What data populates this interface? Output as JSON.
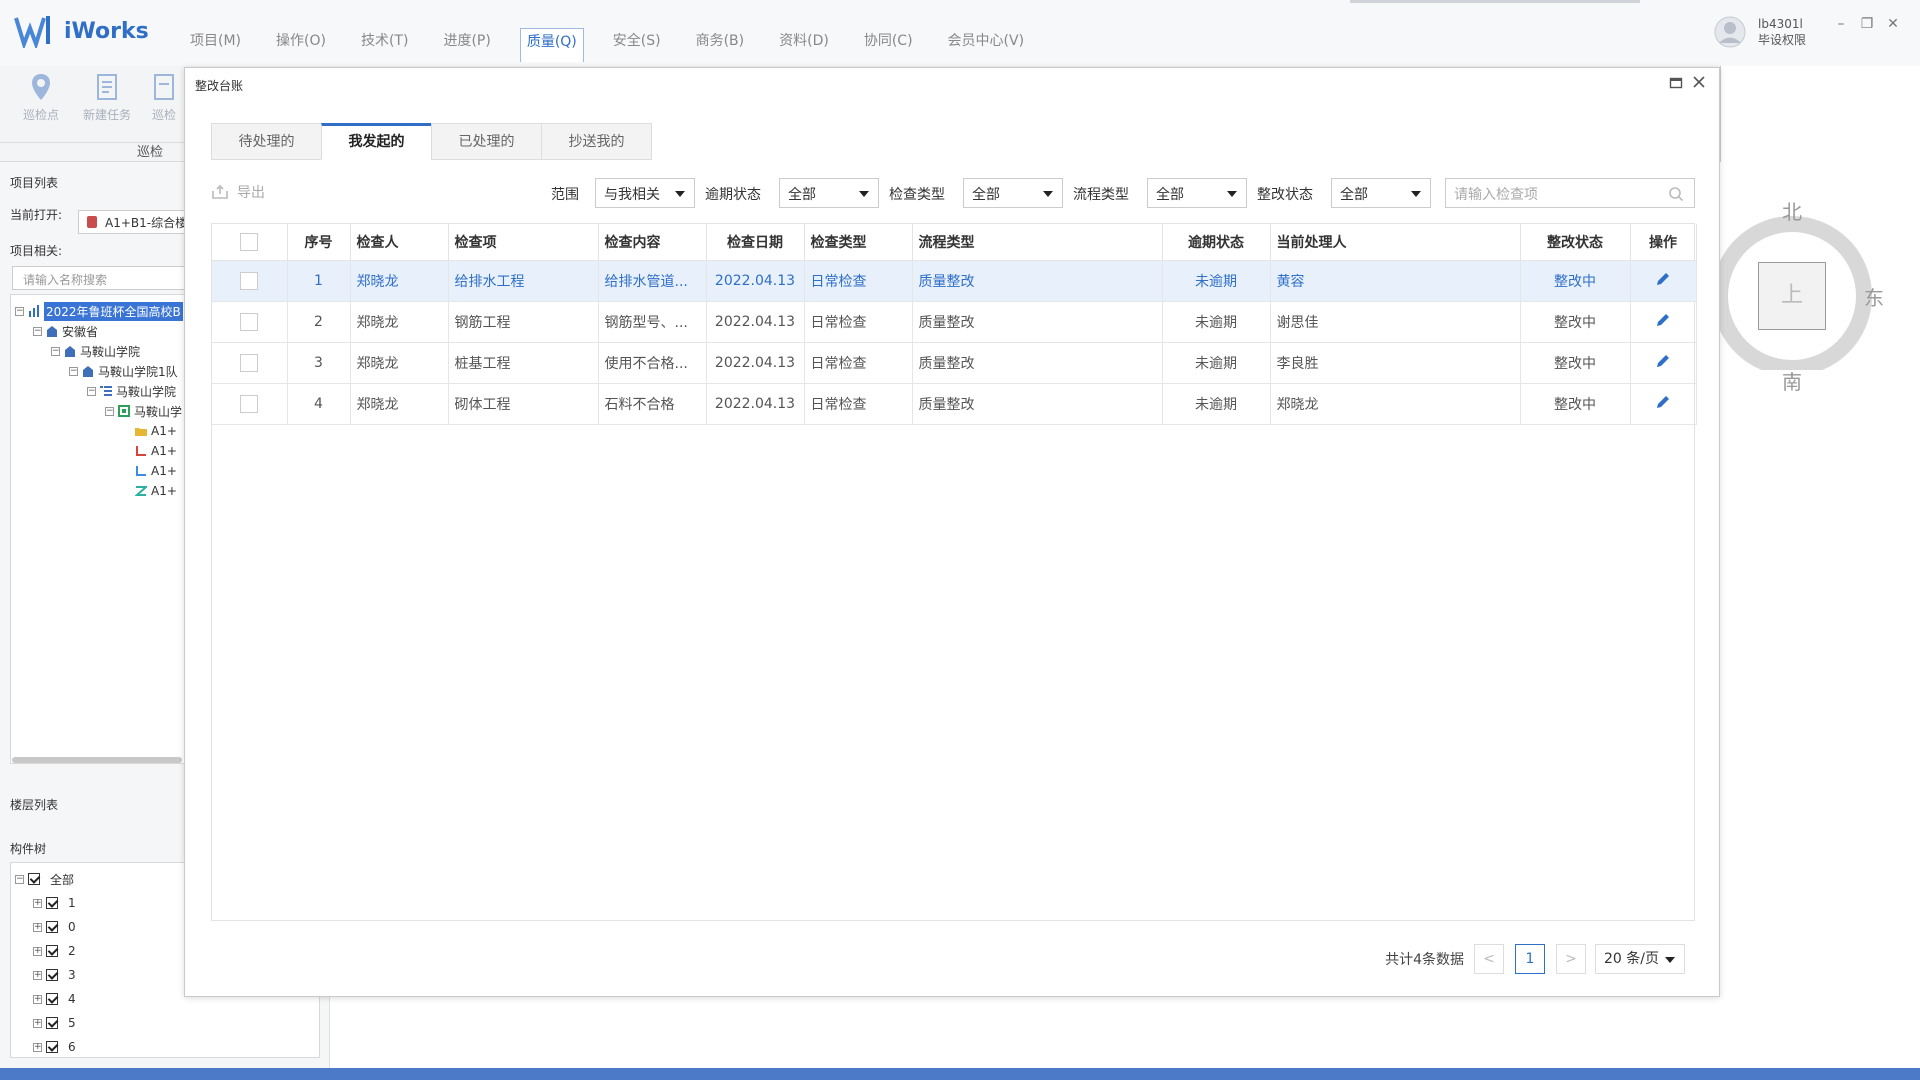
{
  "app": {
    "name": "iWorks"
  },
  "menus": [
    {
      "label": "项目(M)"
    },
    {
      "label": "操作(O)"
    },
    {
      "label": "技术(T)"
    },
    {
      "label": "进度(P)"
    },
    {
      "label": "质量(Q)",
      "active": true
    },
    {
      "label": "安全(S)"
    },
    {
      "label": "商务(B)"
    },
    {
      "label": "资料(D)"
    },
    {
      "label": "协同(C)"
    },
    {
      "label": "会员中心(V)"
    }
  ],
  "user": {
    "name": "lb4301l",
    "role": "毕设权限"
  },
  "window_controls": {
    "minimize": "–",
    "restore": "❐",
    "close": "✕"
  },
  "ribbon": {
    "buttons": [
      {
        "label": "巡检点"
      },
      {
        "label": "新建任务"
      },
      {
        "label": "巡检"
      }
    ],
    "group_label": "巡检"
  },
  "left_panel": {
    "project_list_title": "项目列表",
    "current_open_label": "当前打开:",
    "current_open_value": "A1+B1-综合楼",
    "project_related_label": "项目相关:",
    "search_placeholder": "请输入名称搜索",
    "tree": [
      {
        "label": "2022年鲁班杯全国高校B"
      },
      {
        "label": "安徽省"
      },
      {
        "label": "马鞍山学院"
      },
      {
        "label": "马鞍山学院1队"
      },
      {
        "label": "马鞍山学院"
      },
      {
        "label": "马鞍山学"
      },
      {
        "label": "A1+"
      },
      {
        "label": "A1+"
      },
      {
        "label": "A1+"
      },
      {
        "label": "A1+"
      }
    ],
    "floor_list_title": "楼层列表",
    "component_tree_title": "构件树",
    "component_tree": [
      {
        "label": "全部"
      },
      {
        "label": "1"
      },
      {
        "label": "0"
      },
      {
        "label": "2"
      },
      {
        "label": "3"
      },
      {
        "label": "4"
      },
      {
        "label": "5"
      },
      {
        "label": "6"
      }
    ]
  },
  "compass": {
    "north": "北",
    "east": "东",
    "south": "南",
    "center": "上"
  },
  "dialog": {
    "title": "整改台账",
    "tabs": [
      {
        "label": "待处理的"
      },
      {
        "label": "我发起的",
        "active": true
      },
      {
        "label": "已处理的"
      },
      {
        "label": "抄送我的"
      }
    ],
    "export_label": "导出",
    "filters": [
      {
        "label": "范围",
        "value": "与我相关"
      },
      {
        "label": "逾期状态",
        "value": "全部"
      },
      {
        "label": "检查类型",
        "value": "全部"
      },
      {
        "label": "流程类型",
        "value": "全部"
      },
      {
        "label": "整改状态",
        "value": "全部"
      }
    ],
    "search_placeholder": "请输入检查项",
    "table": {
      "columns": [
        "序号",
        "检查人",
        "检查项",
        "检查内容",
        "检查日期",
        "检查类型",
        "流程类型",
        "逾期状态",
        "当前处理人",
        "整改状态",
        "操作"
      ],
      "rows": [
        [
          "1",
          "郑晓龙",
          "给排水工程",
          "给排水管道...",
          "2022.04.13",
          "日常检查",
          "质量整改",
          "未逾期",
          "黄容",
          "整改中"
        ],
        [
          "2",
          "郑晓龙",
          "钢筋工程",
          "钢筋型号、...",
          "2022.04.13",
          "日常检查",
          "质量整改",
          "未逾期",
          "谢思佳",
          "整改中"
        ],
        [
          "3",
          "郑晓龙",
          "桩基工程",
          "使用不合格...",
          "2022.04.13",
          "日常检查",
          "质量整改",
          "未逾期",
          "李良胜",
          "整改中"
        ],
        [
          "4",
          "郑晓龙",
          "砌体工程",
          "石料不合格",
          "2022.04.13",
          "日常检查",
          "质量整改",
          "未逾期",
          "郑晓龙",
          "整改中"
        ]
      ],
      "selected_row": 0
    },
    "pager": {
      "total_text": "共计4条数据",
      "prev": "<",
      "current_page": "1",
      "next": ">",
      "page_size": "20 条/页"
    }
  },
  "colors": {
    "accent": "#2f6fc8",
    "selected_row_bg": "#e8f0fc",
    "bottom_bar": "#4d79c9"
  }
}
